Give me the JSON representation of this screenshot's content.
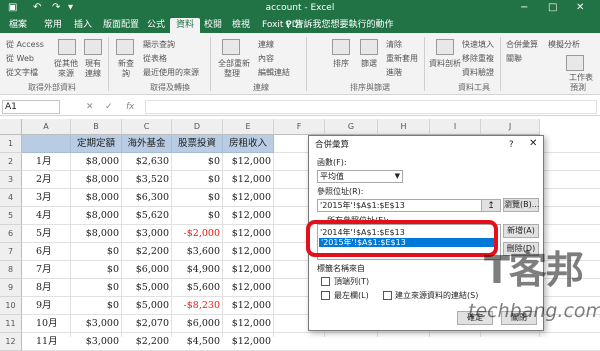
{
  "window": {
    "title": "account - Excel",
    "minimize": "−",
    "restore": "□",
    "close": "✕"
  },
  "tabs": [
    "檔案",
    "常用",
    "插入",
    "版面配置",
    "公式",
    "資料",
    "校閱",
    "檢視",
    "Foxit PDF"
  ],
  "active_tab": "資料",
  "tell_me": "♀ 告訴我您想要執行的動作",
  "ribbon": {
    "get_external": {
      "items": [
        "從 Access",
        "從 Web",
        "從文字檔"
      ],
      "group": "取得外部資料"
    },
    "query": {
      "items": [
        "從其他",
        "來源",
        "現有",
        "連線",
        "新查",
        "詢"
      ],
      "group": "取得及轉換"
    },
    "query_links": [
      "顯示查詢",
      "從表格",
      "最近使用的來源"
    ],
    "connections": {
      "items": [
        "全部重新",
        "整理"
      ],
      "links": [
        "連線",
        "內容",
        "編輯連結"
      ],
      "group": "連線"
    },
    "sort": {
      "items": [
        "排序",
        "篩選"
      ],
      "links": [
        "清除",
        "重新套用",
        "進階"
      ],
      "group": "排序與篩選"
    },
    "tools": {
      "items": [
        "資料剖析"
      ],
      "links": [
        "快速填入",
        "移除重複",
        "資料驗證"
      ],
      "group": "資料工具"
    },
    "outline": {
      "items": [
        "合併彙算",
        "關聯",
        "模擬分析",
        "預測",
        "工作表"
      ],
      "group": "預測"
    }
  },
  "formula_bar": {
    "name_box": "A1",
    "cancel": "✕",
    "enter": "✓",
    "fx": "fx",
    "value": ""
  },
  "columns": [
    "A",
    "B",
    "C",
    "D",
    "E",
    "F",
    "G",
    "H",
    "I",
    "J"
  ],
  "row_numbers": [
    "1",
    "2",
    "3",
    "4",
    "5",
    "6",
    "7",
    "8",
    "9",
    "10",
    "11",
    "12"
  ],
  "table": {
    "headers": [
      "",
      "定期定額",
      "海外基金",
      "股票投資",
      "房租收入"
    ],
    "rows": [
      [
        "1月",
        "$8,000",
        "$2,630",
        "$0",
        "$12,000"
      ],
      [
        "2月",
        "$8,000",
        "$3,520",
        "$0",
        "$12,000"
      ],
      [
        "3月",
        "$8,000",
        "$6,300",
        "$0",
        "$12,000"
      ],
      [
        "4月",
        "$8,000",
        "$5,620",
        "$0",
        "$12,000"
      ],
      [
        "5月",
        "$8,000",
        "$3,000",
        "-$2,000",
        "$12,000"
      ],
      [
        "6月",
        "$0",
        "$2,200",
        "$3,600",
        "$12,000"
      ],
      [
        "7月",
        "$0",
        "$6,000",
        "$4,900",
        "$12,000"
      ],
      [
        "8月",
        "$0",
        "$5,000",
        "$5,600",
        "$12,000"
      ],
      [
        "9月",
        "$0",
        "$5,000",
        "-$8,230",
        "$12,000"
      ],
      [
        "10月",
        "$3,000",
        "$2,070",
        "$6,000",
        "$12,000"
      ],
      [
        "11月",
        "$3,000",
        "$2,200",
        "$4,500",
        "$12,000"
      ]
    ],
    "negative_color": "#e0201a"
  },
  "dialog": {
    "title": "合併彙算",
    "help": "?",
    "close": "✕",
    "function_label": "函數(F):",
    "function_value": "平均值",
    "reference_label": "參照位址(R):",
    "reference_value": "'2015年'!$A$1:$E$13",
    "browse_button": "瀏覽(B)...",
    "all_references_label": "所有參照位址(E):",
    "references": [
      "'2014年'!$A$1:$E$13",
      "'2015年'!$A$1:$E$13"
    ],
    "selected_reference": "'2015年'!$A$1:$E$13",
    "add_button": "新增(A)",
    "delete_button": "刪除(D)",
    "labels_group": "標籤名稱來自",
    "top_row": "頂端列(T)",
    "left_column": "最左欄(L)",
    "link_source": "建立來源資料的連結(S)",
    "ok_button": "確定",
    "close_button": "關閉"
  },
  "watermark": {
    "logo": "T客邦",
    "url": "techbang.com"
  }
}
